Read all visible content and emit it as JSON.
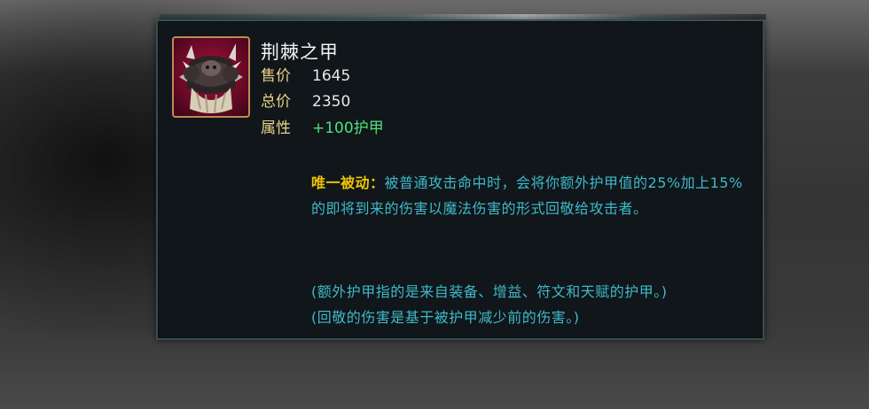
{
  "item": {
    "name": "荆棘之甲",
    "icon": "thornmail-icon",
    "stats": [
      {
        "label": "售价",
        "value": "1645",
        "color": "#e8e8e8"
      },
      {
        "label": "总价",
        "value": "2350",
        "color": "#e8e8e8"
      },
      {
        "label": "属性",
        "value": "+100护甲",
        "color": "#4fe07a"
      }
    ],
    "passive": {
      "label": "唯一被动：",
      "text": "被普通攻击命中时，会将你额外护甲值的25%加上15%的即将到来的伤害以魔法伤害的形式回敬给攻击者。"
    },
    "notes": [
      "(额外护甲指的是来自装备、增益、符文和天赋的护甲。)",
      "(回敬的伤害是基于被护甲减少前的伤害。)"
    ]
  },
  "colors": {
    "label_gold": "#e8d38a",
    "unique_yellow": "#f0c400",
    "description_cyan": "#3fb9c8",
    "stat_green": "#4fe07a",
    "border_teal": "#35504f"
  }
}
